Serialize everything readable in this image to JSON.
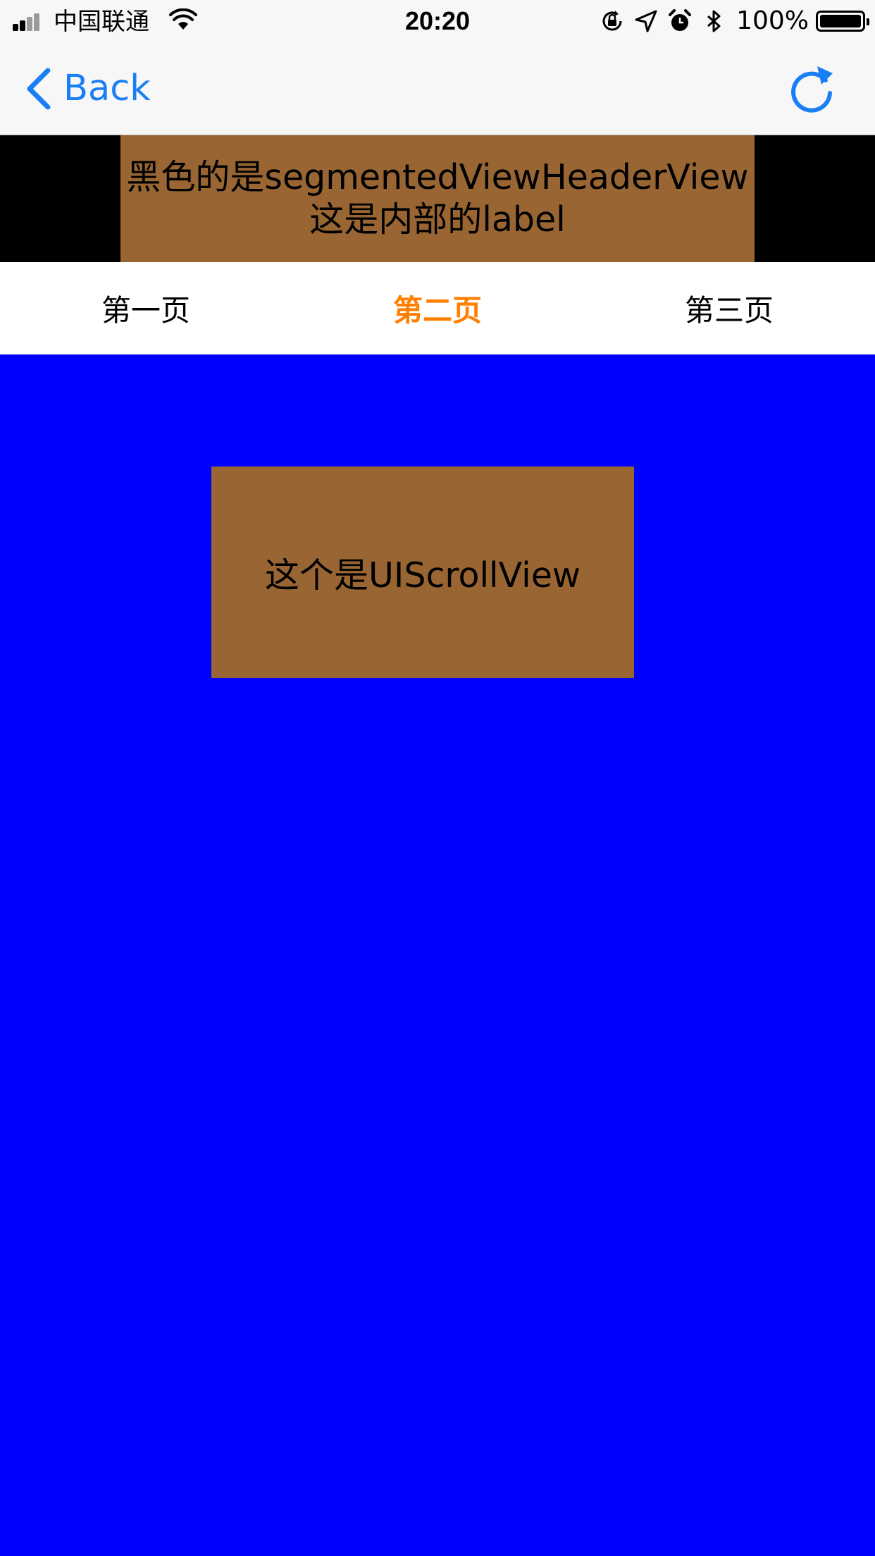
{
  "status_bar": {
    "carrier": "中国联通",
    "time": "20:20",
    "battery_percent": "100%",
    "battery_level": 1.0,
    "signal_bars": 2,
    "icons": [
      "signal-icon",
      "wifi-icon",
      "orientation-lock-icon",
      "location-icon",
      "alarm-icon",
      "bluetooth-icon",
      "battery-icon"
    ]
  },
  "nav_bar": {
    "back_label": "Back",
    "back_icon": "chevron-left-icon",
    "refresh_icon": "refresh-icon",
    "tint_color": "#1a7ff5"
  },
  "header_view": {
    "background_color": "#000000",
    "label_background_color": "#996633",
    "label_line1": "黑色的是segmentedViewHeaderView",
    "label_line2": "这是内部的label"
  },
  "tabs": {
    "items": [
      {
        "label": "第一页",
        "active": false
      },
      {
        "label": "第二页",
        "active": true
      },
      {
        "label": "第三页",
        "active": false
      }
    ],
    "active_color": "#ff7f00",
    "inactive_color": "#000000"
  },
  "content": {
    "background_color": "#0000ff",
    "scroll_view_label": "这个是UIScrollView",
    "scroll_view_background": "#996633"
  }
}
